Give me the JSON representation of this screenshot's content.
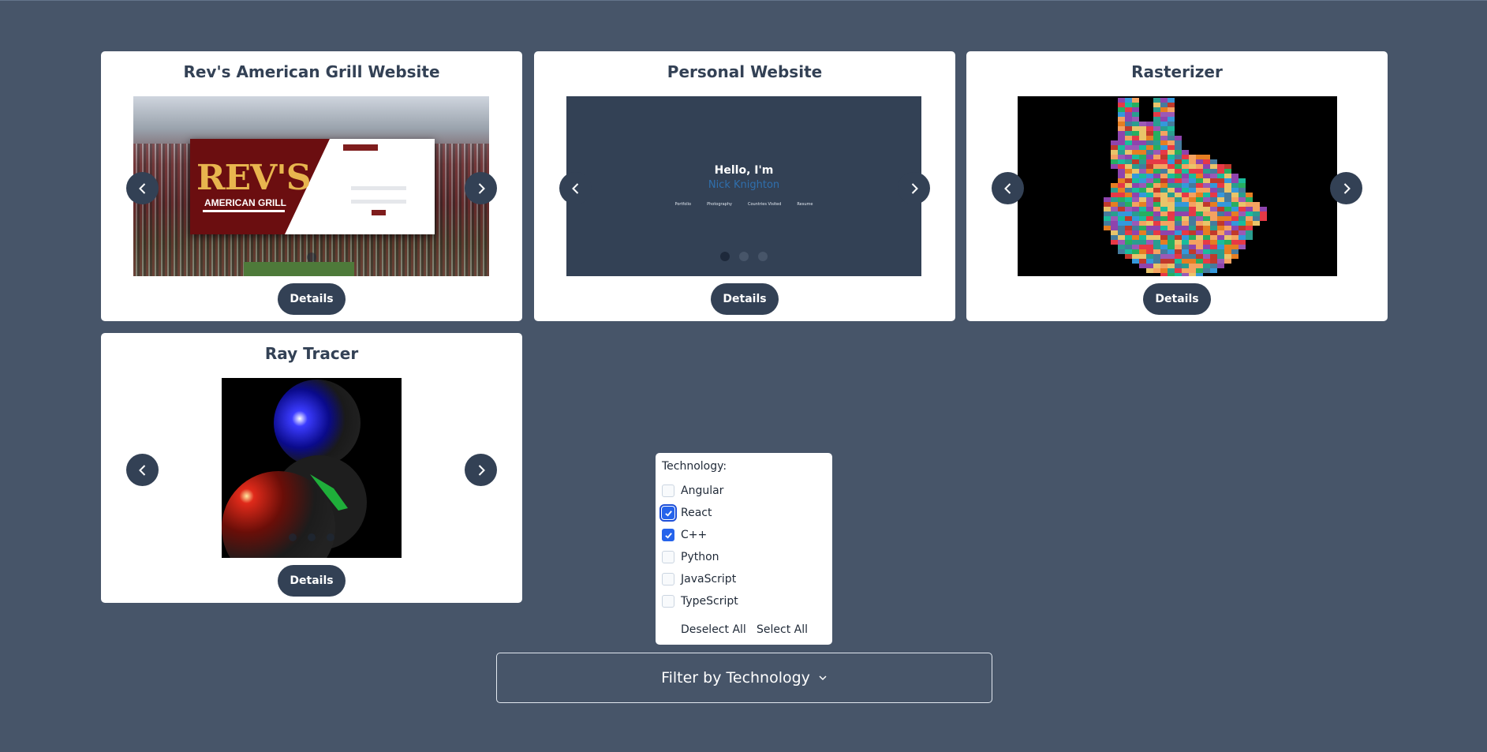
{
  "projects": [
    {
      "title": "Rev's American Grill Website",
      "details_label": "Details",
      "preview": {
        "logo_text": "REV'S",
        "subtitle": "AMERICAN GRILL"
      }
    },
    {
      "title": "Personal Website",
      "details_label": "Details",
      "preview": {
        "greeting": "Hello, I'm",
        "name": "Nick Knighton",
        "nav": [
          "Portfolio",
          "Photography",
          "Countries Visited",
          "Resume"
        ]
      }
    },
    {
      "title": "Rasterizer",
      "details_label": "Details"
    },
    {
      "title": "Ray Tracer",
      "details_label": "Details"
    }
  ],
  "filter_popup": {
    "heading": "Technology:",
    "options": [
      {
        "label": "Angular",
        "checked": false
      },
      {
        "label": "React",
        "checked": true
      },
      {
        "label": "C++",
        "checked": true
      },
      {
        "label": "Python",
        "checked": false
      },
      {
        "label": "JavaScript",
        "checked": false
      },
      {
        "label": "TypeScript",
        "checked": false
      }
    ],
    "deselect_all_label": "Deselect All",
    "select_all_label": "Select All"
  },
  "filter_button": {
    "label": "Filter by Technology",
    "icon": "chevron-down-icon"
  },
  "colors": {
    "background": "#475569",
    "card": "#ffffff",
    "accent_dark": "#334155",
    "checkbox_checked": "#2563eb"
  }
}
